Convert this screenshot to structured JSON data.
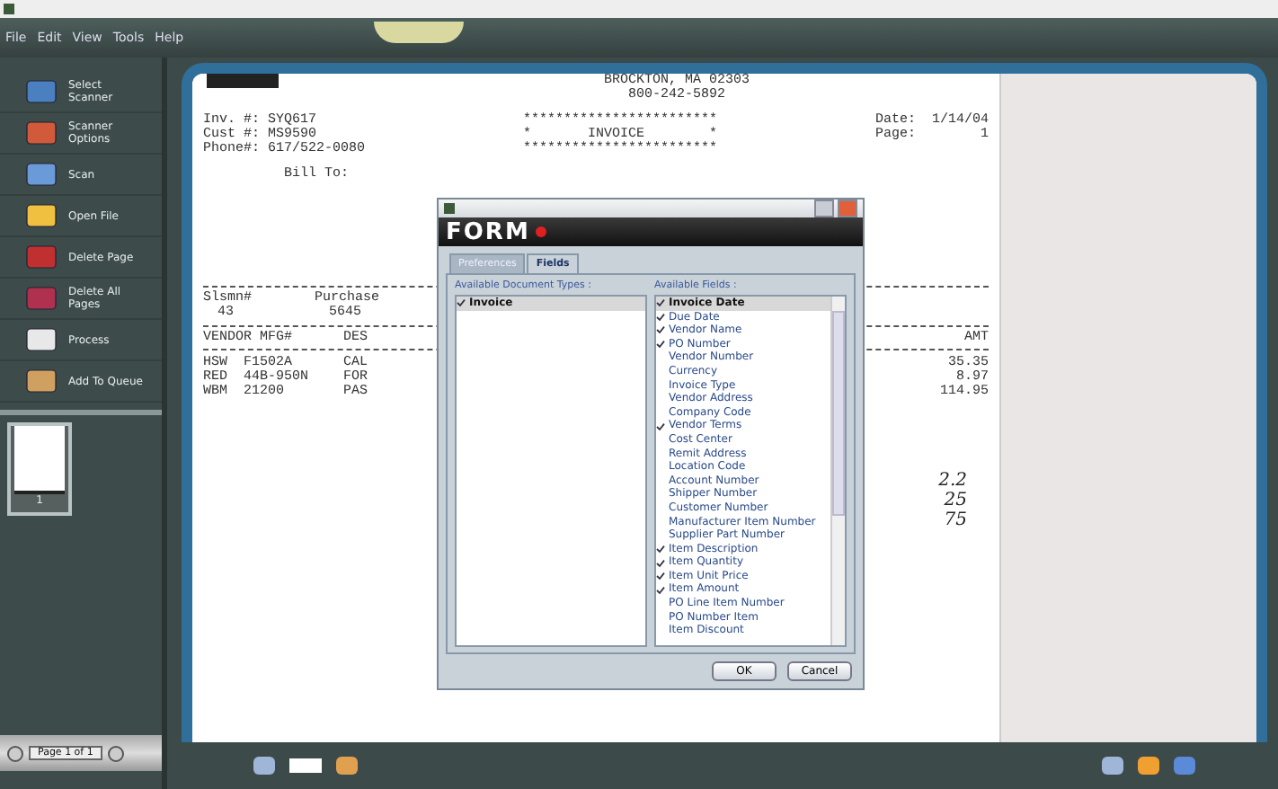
{
  "menu": [
    "File",
    "Edit",
    "View",
    "Tools",
    "Help"
  ],
  "sidebar": {
    "tools": [
      {
        "label": "Select Scanner"
      },
      {
        "label": "Scanner Options"
      },
      {
        "label": "Scan"
      },
      {
        "label": "Open File"
      },
      {
        "label": "Delete Page"
      },
      {
        "label": "Delete All Pages"
      },
      {
        "label": "Process"
      },
      {
        "label": "Add To Queue"
      }
    ],
    "thumbnail_label": "1",
    "page_nav": "Page 1 of 1"
  },
  "document": {
    "address": [
      "BROCKTON, MA 02303",
      "800-242-5892"
    ],
    "banner": [
      "************************",
      "*       INVOICE        *",
      "************************"
    ],
    "left_info": [
      "Inv. #: SYQ617",
      "Cust #: MS9590",
      "Phone#: 617/522-0080"
    ],
    "right_info": [
      "Date:  1/14/04",
      "Page:        1"
    ],
    "bill_to": "Bill To:",
    "summary": [
      {
        "label": "Slsmn#",
        "value": "43"
      },
      {
        "label": "Purchase",
        "value": "5645"
      }
    ],
    "columns": [
      "VENDOR MFG#",
      "DES",
      "AMT"
    ],
    "rows": [
      {
        "vendor": "HSW  F1502A",
        "desc": "CAL",
        "amount": "35.35"
      },
      {
        "vendor": "RED  44B-950N",
        "desc": "FOR",
        "amount": "8.97"
      },
      {
        "vendor": "WBM  21200",
        "desc": "PAS",
        "amount": "114.95"
      }
    ],
    "handwriting": [
      "2.2",
      "25",
      "75"
    ]
  },
  "dialog": {
    "logo": "FORM",
    "tabs": [
      {
        "label": "Preferences",
        "selected": false
      },
      {
        "label": "Fields",
        "selected": true
      }
    ],
    "doc_types_label": "Available Document Types :",
    "doc_types": [
      {
        "label": "Invoice",
        "checked": true,
        "selected": true
      }
    ],
    "fields_label": "Available Fields :",
    "fields": [
      {
        "label": "Invoice Date",
        "checked": true,
        "selected": true
      },
      {
        "label": "Due Date",
        "checked": true,
        "selected": false
      },
      {
        "label": "Vendor Name",
        "checked": true,
        "selected": false
      },
      {
        "label": "PO Number",
        "checked": true,
        "selected": false
      },
      {
        "label": "Vendor Number",
        "checked": false,
        "selected": false
      },
      {
        "label": "Currency",
        "checked": false,
        "selected": false
      },
      {
        "label": "Invoice Type",
        "checked": false,
        "selected": false
      },
      {
        "label": "Vendor Address",
        "checked": false,
        "selected": false
      },
      {
        "label": "Company Code",
        "checked": false,
        "selected": false
      },
      {
        "label": "Vendor Terms",
        "checked": true,
        "selected": false
      },
      {
        "label": "Cost Center",
        "checked": false,
        "selected": false
      },
      {
        "label": "Remit Address",
        "checked": false,
        "selected": false
      },
      {
        "label": "Location Code",
        "checked": false,
        "selected": false
      },
      {
        "label": "Account Number",
        "checked": false,
        "selected": false
      },
      {
        "label": "Shipper Number",
        "checked": false,
        "selected": false
      },
      {
        "label": "Customer Number",
        "checked": false,
        "selected": false
      },
      {
        "label": "Manufacturer Item Number",
        "checked": false,
        "selected": false
      },
      {
        "label": "Supplier Part Number",
        "checked": false,
        "selected": false
      },
      {
        "label": "Item Description",
        "checked": true,
        "selected": false
      },
      {
        "label": "Item Quantity",
        "checked": true,
        "selected": false
      },
      {
        "label": "Item Unit Price",
        "checked": true,
        "selected": false
      },
      {
        "label": "Item Amount",
        "checked": true,
        "selected": false
      },
      {
        "label": "PO Line Item Number",
        "checked": false,
        "selected": false
      },
      {
        "label": "PO Number Item",
        "checked": false,
        "selected": false
      },
      {
        "label": "Item Discount",
        "checked": false,
        "selected": false
      }
    ],
    "buttons": [
      "OK",
      "Cancel"
    ]
  }
}
